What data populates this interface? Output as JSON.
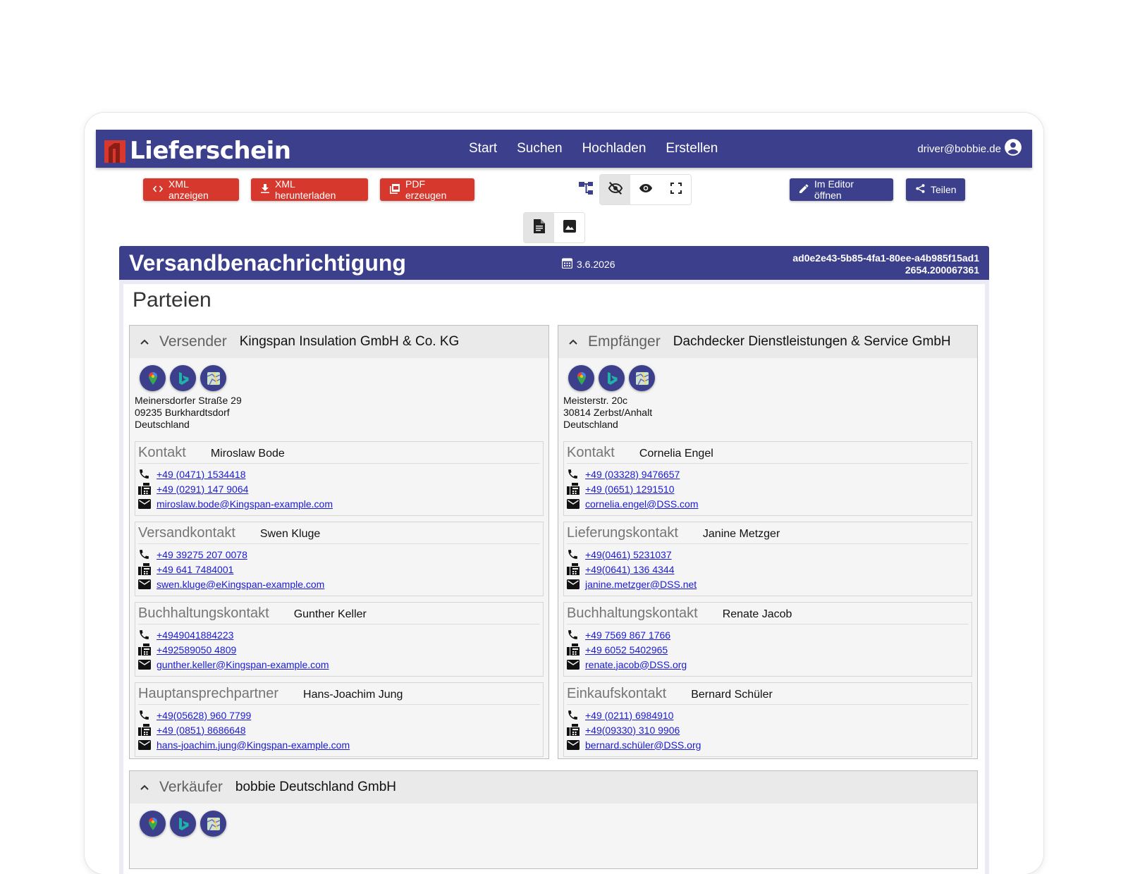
{
  "app": {
    "logo_text": "Lieferschein",
    "nav": [
      "Start",
      "Suchen",
      "Hochladen",
      "Erstellen"
    ],
    "user_email": "driver@bobbie.de"
  },
  "toolbar": {
    "xml_show": "XML anzeigen",
    "xml_download": "XML herunterladen",
    "pdf_create": "PDF erzeugen",
    "open_editor": "Im Editor öffnen",
    "share": "Teilen"
  },
  "document": {
    "title": "Versandbenachrichtigung",
    "date": "3.6.2026",
    "id_line1": "ad0e2e43-5b85-4fa1-80ee-a4b985f15ad1",
    "id_line2": "2654.200067361",
    "section_title": "Parteien"
  },
  "parties": [
    {
      "role": "Versender",
      "name": "Kingspan Insulation GmbH & Co. KG",
      "address": [
        "Meinersdorfer Straße 29",
        "09235 Burkhardtsdorf",
        "Deutschland"
      ],
      "contacts": [
        {
          "role": "Kontakt",
          "name": "Miroslaw Bode",
          "phone": "+49 (0471) 1534418",
          "fax": "+49 (0291) 147 9064",
          "email": "miroslaw.bode@Kingspan-example.com"
        },
        {
          "role": "Versandkontakt",
          "name": "Swen Kluge",
          "phone": "+49 39275 207 0078",
          "fax": "+49 641 7484001",
          "email": "swen.kluge@eKingspan-example.com"
        },
        {
          "role": "Buchhaltungskontakt",
          "name": "Gunther Keller",
          "phone": "+4949041884223",
          "fax": "+492589050 4809",
          "email": "gunther.keller@Kingspan-example.com"
        },
        {
          "role": "Hauptansprechpartner",
          "name": "Hans-Joachim Jung",
          "phone": "+49(05628) 960 7799",
          "fax": "+49 (0851) 8686648",
          "email": "hans-joachim.jung@Kingspan-example.com"
        }
      ]
    },
    {
      "role": "Empfänger",
      "name": "Dachdecker Dienstleistungen & Service GmbH",
      "address": [
        "Meisterstr. 20c",
        "30814 Zerbst/Anhalt",
        "Deutschland"
      ],
      "contacts": [
        {
          "role": "Kontakt",
          "name": "Cornelia Engel",
          "phone": "+49 (03328) 9476657",
          "fax": "+49 (0651) 1291510",
          "email": "cornelia.engel@DSS.com"
        },
        {
          "role": "Lieferungskontakt",
          "name": "Janine Metzger",
          "phone": "+49(0461) 5231037",
          "fax": "+49(0641) 136 4344",
          "email": "janine.metzger@DSS.net"
        },
        {
          "role": "Buchhaltungskontakt",
          "name": "Renate Jacob",
          "phone": "+49 7569 867 1766",
          "fax": "+49 6052 5402965",
          "email": "renate.jacob@DSS.org"
        },
        {
          "role": "Einkaufskontakt",
          "name": "Bernard Schüler",
          "phone": "+49 (0211) 6984910",
          "fax": "+49(09330) 310 9906",
          "email": "bernard.schüler@DSS.org"
        }
      ]
    }
  ],
  "seller": {
    "role": "Verkäufer",
    "name": "bobbie Deutschland GmbH"
  },
  "colors": {
    "primary": "#3c3f8c",
    "danger": "#d6382e",
    "link": "#1a1ad6"
  },
  "icons": [
    "code-icon",
    "download-icon",
    "pdf-icon",
    "tree-icon",
    "eye-off-icon",
    "eye-icon",
    "fullscreen-icon",
    "edit-icon",
    "share-icon",
    "document-icon",
    "image-icon",
    "calendar-icon",
    "phone-icon",
    "fax-icon",
    "mail-icon",
    "google-maps-icon",
    "bing-maps-icon",
    "osm-maps-icon",
    "account-icon",
    "chevron-up-icon"
  ]
}
